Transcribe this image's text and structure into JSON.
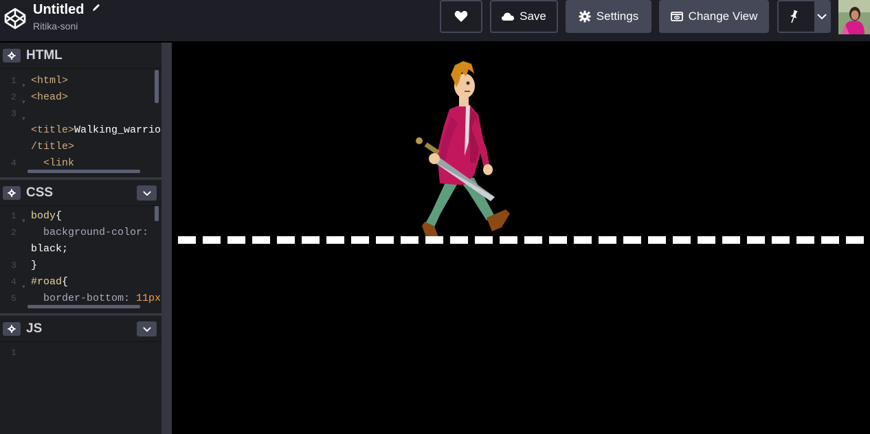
{
  "header": {
    "title": "Untitled",
    "owner": "Ritika-soni",
    "buttons": {
      "save": "Save",
      "settings": "Settings",
      "change_view": "Change View"
    }
  },
  "panels": {
    "html": {
      "title": "HTML",
      "lines": [
        {
          "num": "1",
          "text": "<html>"
        },
        {
          "num": "2",
          "text": "<head>"
        },
        {
          "num": "3",
          "text": ""
        },
        {
          "num": "",
          "text_tag_open": "<title>",
          "text_body": "Walking_warrio",
          "text_tail": "/title>"
        },
        {
          "num": "4",
          "text": "  <link"
        }
      ]
    },
    "css": {
      "title": "CSS",
      "lines": [
        {
          "num": "1",
          "sel": "body",
          "punct": "{"
        },
        {
          "num": "2",
          "prop": "  background-color:",
          "val": "black;"
        },
        {
          "num": "3",
          "punct": "}"
        },
        {
          "num": "4",
          "sel": "#road",
          "punct": "{"
        },
        {
          "num": "5",
          "prop": "  border-bottom:",
          "val": "11px"
        }
      ]
    },
    "js": {
      "title": "JS",
      "lines": [
        {
          "num": "1"
        }
      ]
    }
  },
  "colors": {
    "header_bg": "#1e1f26",
    "button_bg": "#444857",
    "editor_bg": "#1d1e22",
    "preview_bg": "#000000",
    "road": "#ffffff",
    "shirt": "#c2185b",
    "pants": "#5e9e7e"
  }
}
